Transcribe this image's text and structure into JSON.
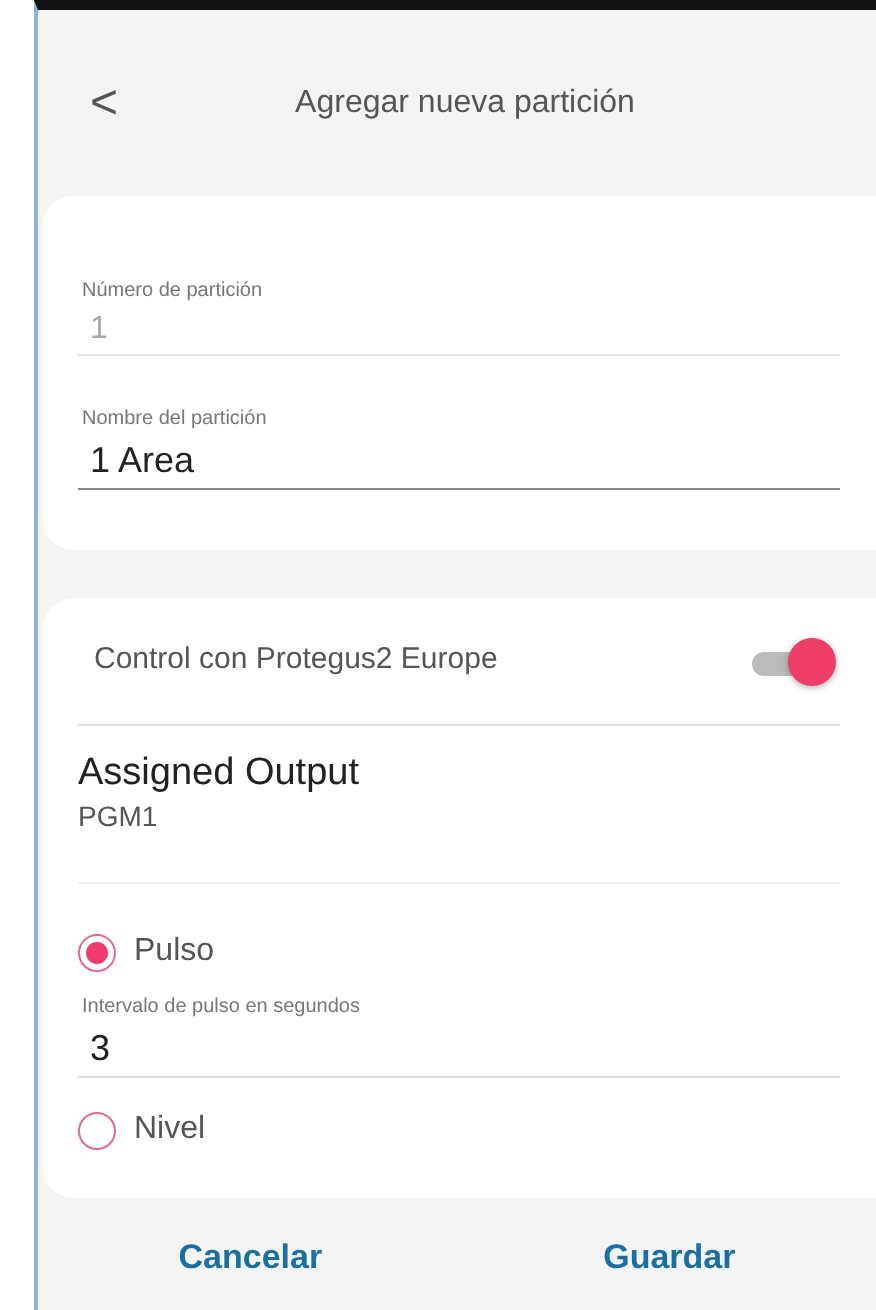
{
  "header": {
    "back": "<",
    "title": "Agregar nueva partición"
  },
  "fields": [
    {
      "label": "Número de partición",
      "value": "1",
      "disabled": true
    },
    {
      "label": "Nombre del partición",
      "value": "1 Area",
      "disabled": false
    }
  ],
  "control": {
    "label": "Control con Protegus2 Europe",
    "on": true
  },
  "output": {
    "title": "Assigned Output",
    "value": "PGM1"
  },
  "modes": [
    {
      "label": "Pulso",
      "selected": true,
      "field": {
        "label": "Intervalo de pulso en segundos",
        "value": "3"
      }
    },
    {
      "label": "Nivel",
      "selected": false
    }
  ],
  "buttons": [
    "Cancelar",
    "Guardar"
  ]
}
